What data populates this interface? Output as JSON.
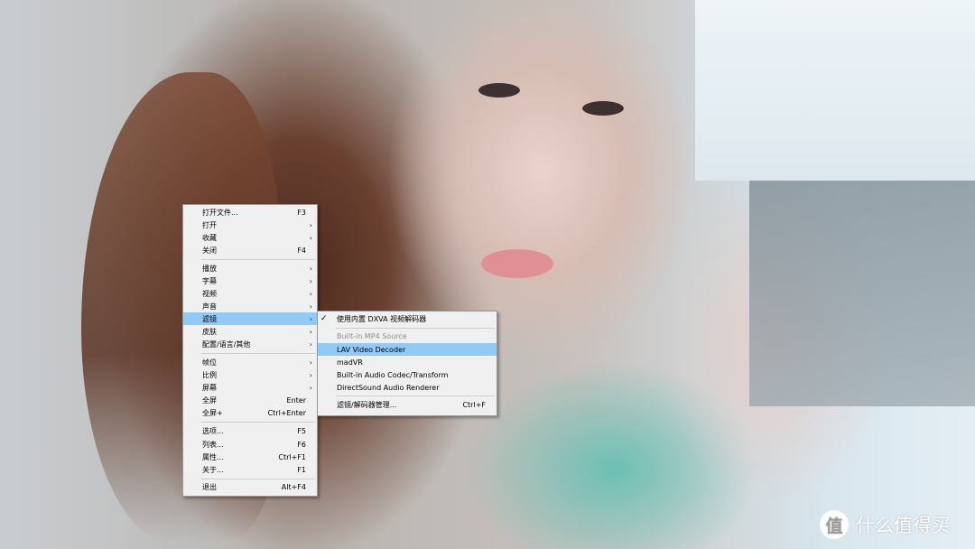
{
  "main_menu": {
    "items": [
      {
        "label": "打开文件...",
        "accel": "F3"
      },
      {
        "label": "打开",
        "submenu": true
      },
      {
        "label": "收藏",
        "submenu": true
      },
      {
        "label": "关闭",
        "accel": "F4"
      },
      {
        "label": "播放",
        "submenu": true
      },
      {
        "label": "字幕",
        "submenu": true
      },
      {
        "label": "视频",
        "submenu": true
      },
      {
        "label": "声音",
        "submenu": true
      },
      {
        "label": "滤镜",
        "submenu": true,
        "highlighted": true
      },
      {
        "label": "皮肤",
        "submenu": true
      },
      {
        "label": "配置/语言/其他",
        "submenu": true
      },
      {
        "label": "帧位",
        "submenu": true
      },
      {
        "label": "比例",
        "submenu": true
      },
      {
        "label": "屏幕",
        "submenu": true
      },
      {
        "label": "全屏",
        "accel": "Enter"
      },
      {
        "label": "全屏+",
        "accel": "Ctrl+Enter"
      },
      {
        "label": "选项...",
        "accel": "F5"
      },
      {
        "label": "列表...",
        "accel": "F6"
      },
      {
        "label": "属性...",
        "accel": "Ctrl+F1"
      },
      {
        "label": "关于...",
        "accel": "F1"
      },
      {
        "label": "退出",
        "accel": "Alt+F4"
      }
    ],
    "arrow_glyph": "›"
  },
  "filter_submenu": {
    "items": [
      {
        "label": "使用内置 DXVA 视频解码器",
        "checked": true
      },
      {
        "label": "Built-in MP4 Source",
        "disabled": true
      },
      {
        "label": "LAV Video Decoder",
        "highlighted": true
      },
      {
        "label": "madVR"
      },
      {
        "label": "Built-in Audio Codec/Transform"
      },
      {
        "label": "DirectSound Audio Renderer"
      },
      {
        "label": "滤镜/解码器管理...",
        "accel": "Ctrl+F"
      }
    ],
    "check_glyph": "✓"
  },
  "watermark": {
    "logo_glyph": "值",
    "text": "什么值得买"
  },
  "colors": {
    "menu_bg": "#f0f0f0",
    "highlight": "#91c9f7",
    "disabled_text": "#8c8c8c"
  }
}
